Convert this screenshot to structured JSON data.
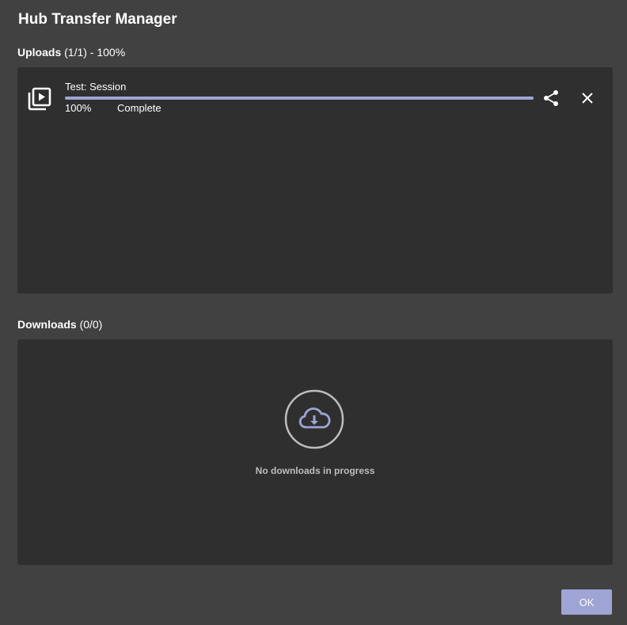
{
  "window": {
    "title": "Hub Transfer Manager"
  },
  "uploads": {
    "label": "Uploads",
    "count": "(1/1) - 100%",
    "items": [
      {
        "name": "Test: Session",
        "icon": "video-library-icon",
        "progress": 1.0,
        "percent_label": "100%",
        "status": "Complete"
      }
    ]
  },
  "downloads": {
    "label": "Downloads",
    "count": "(0/0)",
    "empty_icon": "cloud-download-icon",
    "empty_message": "No downloads in progress"
  },
  "footer": {
    "ok_label": "OK"
  },
  "colors": {
    "accent": "#9ea4d4",
    "background": "#414141",
    "panel": "#2f2f2f"
  }
}
